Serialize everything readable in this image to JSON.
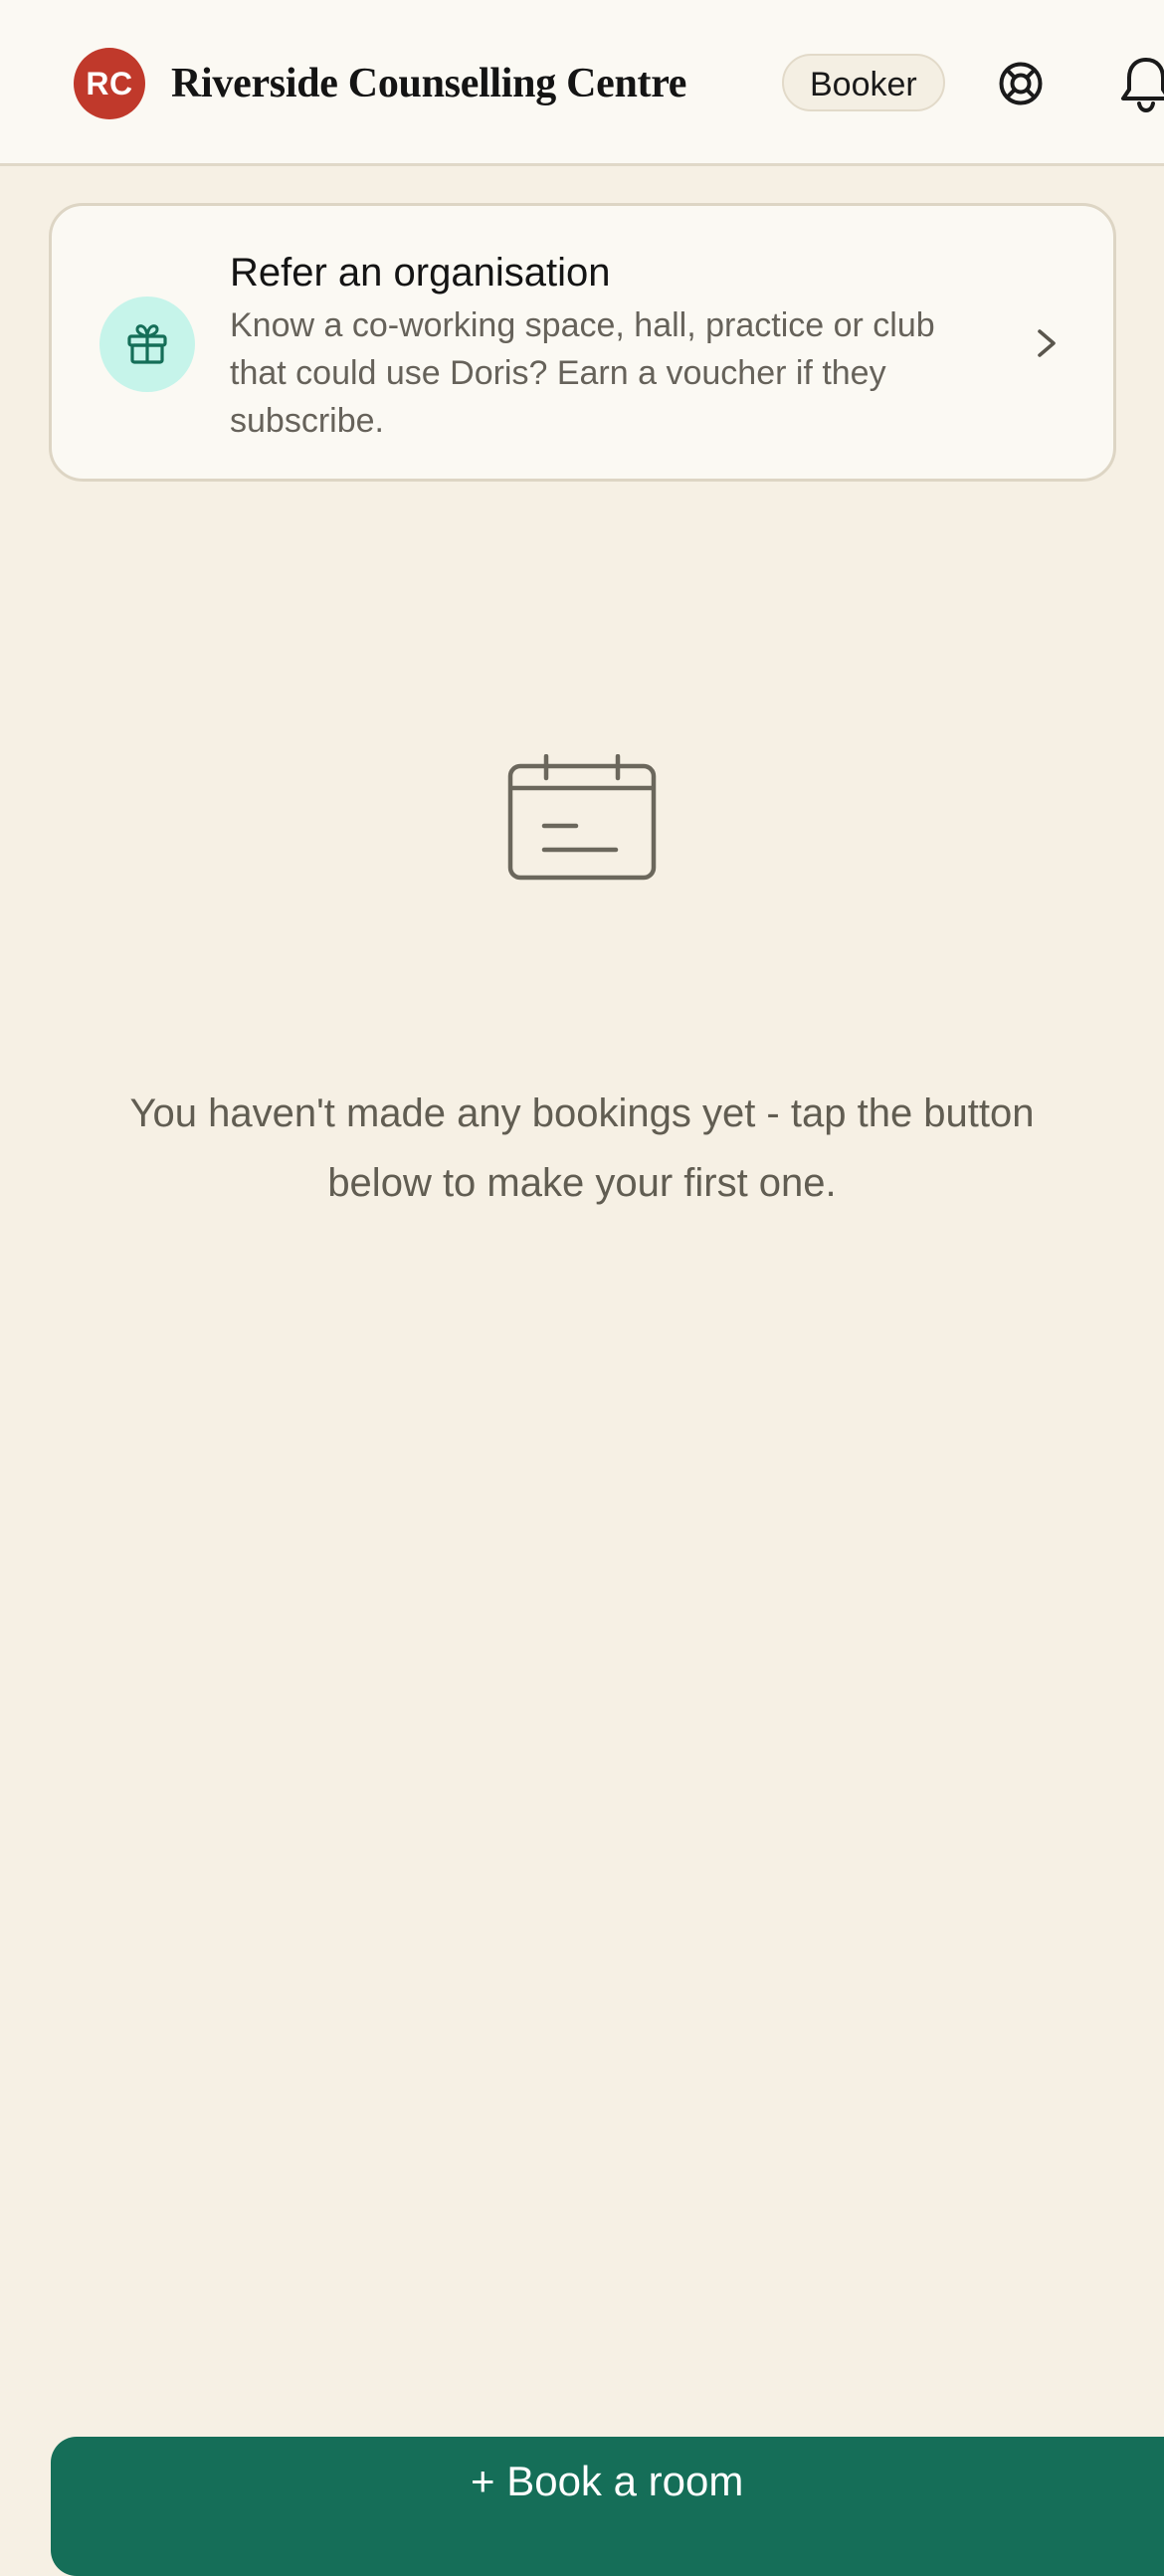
{
  "header": {
    "avatar_initials": "RC",
    "org_name": "Riverside Counselling Centre",
    "role_badge": "Booker",
    "icons": [
      "lifebuoy-icon",
      "bell-icon"
    ],
    "avatar_color": "#c0392b"
  },
  "referral": {
    "title": "Refer an organisation",
    "description": "Know a co-working space, hall, practice or club that could use Doris? Earn a voucher if they subscribe.",
    "icon": "gift-icon",
    "icon_bg_color": "#c6f4ea",
    "icon_color": "#156e58"
  },
  "empty_state": {
    "icon": "calendar-icon",
    "message": "You haven't made any bookings yet - tap the button below to make your first one."
  },
  "cta": {
    "label": "+ Book a room",
    "color": "#156e58"
  },
  "colors": {
    "page_background": "#f6f0e4",
    "header_background": "#fbf9f3"
  }
}
